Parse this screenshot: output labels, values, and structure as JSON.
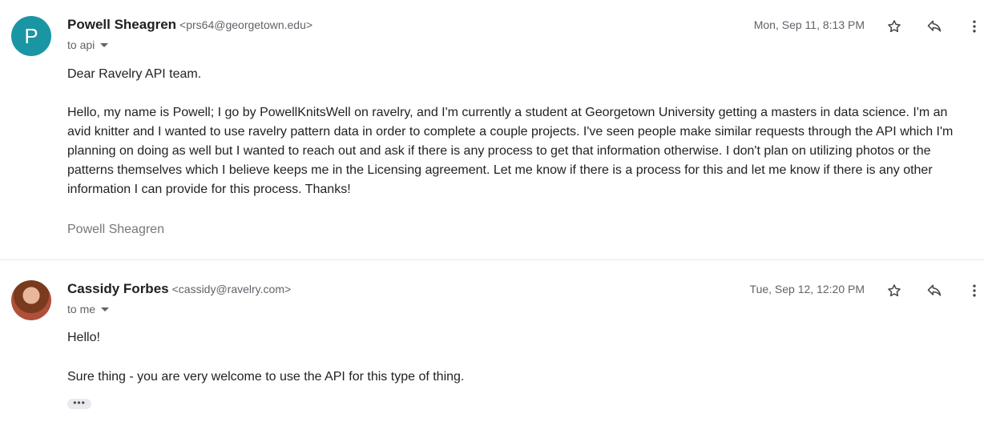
{
  "messages": [
    {
      "avatar_letter": "P",
      "avatar_color": "#1a95a3",
      "sender_name": "Powell Sheagren",
      "sender_email": "<prs64@georgetown.edu>",
      "to": "to api",
      "date": "Mon, Sep 11, 8:13 PM",
      "greeting": "Dear Ravelry API team.",
      "body": "Hello, my name is Powell; I go by PowellKnitsWell on ravelry, and I'm currently a student at Georgetown University getting a masters in data science. I'm an avid knitter and I wanted to use ravelry pattern data in order to complete a couple projects. I've seen people make similar requests through the API which I'm planning on doing as well but I wanted to reach out and ask if there is any process to get that information otherwise. I don't plan on utilizing photos or the patterns themselves which I believe keeps me in the Licensing agreement. Let me know if there is a process for this and let me know if there is any other information I can provide for this process. Thanks!",
      "signature": "Powell Sheagren"
    },
    {
      "sender_name": "Cassidy Forbes",
      "sender_email": "<cassidy@ravelry.com>",
      "to": "to me",
      "date": "Tue, Sep 12, 12:20 PM",
      "greeting": "Hello!",
      "body": "Sure thing -  you are very welcome to use the API for this type of thing.",
      "ellipsis": "•••"
    }
  ],
  "icons": {
    "star": "star-icon",
    "reply": "reply-icon",
    "more": "more-vertical-icon",
    "caret": "chevron-down-icon"
  }
}
